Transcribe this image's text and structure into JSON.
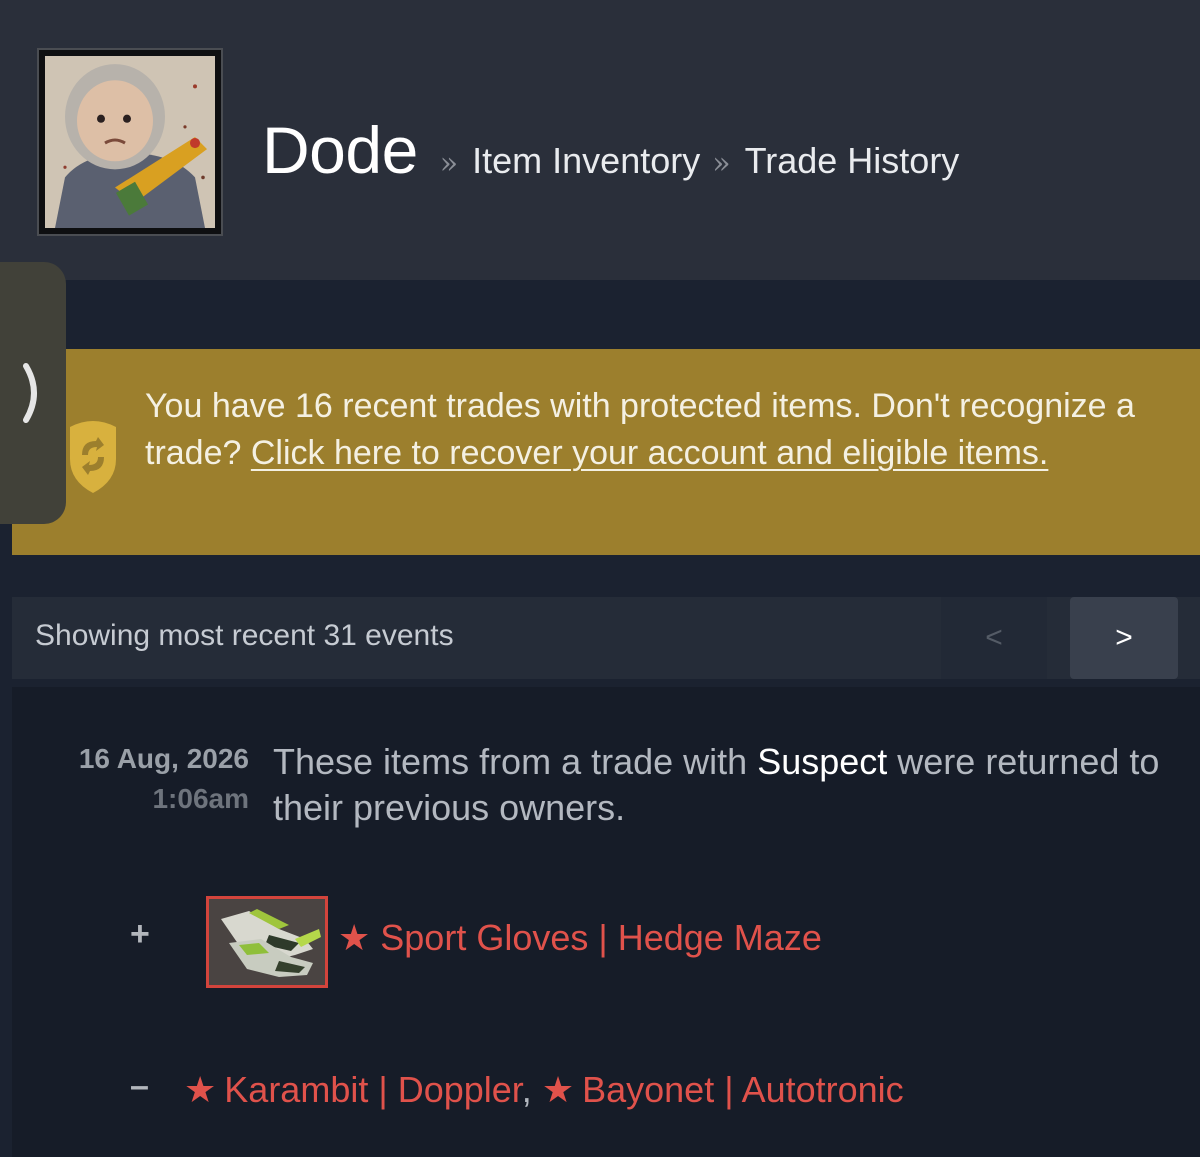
{
  "profile": {
    "name": "Dode",
    "avatar": "profile-avatar"
  },
  "breadcrumb": {
    "separator": "»",
    "items": [
      "Item Inventory",
      "Trade History"
    ]
  },
  "sidebar_tab": {
    "icon": "chevron-right-icon"
  },
  "banner": {
    "icon": "shield-swap-icon",
    "text": "You have 16 recent trades with protected items. Don't recognize a trade?",
    "link_text": "Click here to recover your account and eligible items.",
    "background": "#9c7f2d"
  },
  "events": {
    "summary": "Showing most recent 31 events",
    "prev_label": "<",
    "next_label": ">"
  },
  "trade": {
    "date": "16 Aug, 2026",
    "time": "1:06am",
    "desc_before": "These items from a trade with",
    "partner": "Suspect",
    "desc_after": "were returned to their previous owners.",
    "received_sign": "+",
    "received_item": "★ Sport Gloves | Hedge Maze",
    "given_sign": "–",
    "given_items": [
      "Karambit | Doppler",
      "Bayonet | Autotronic"
    ],
    "given_separator": ",",
    "star": "★",
    "item_color": "#e0524b"
  }
}
